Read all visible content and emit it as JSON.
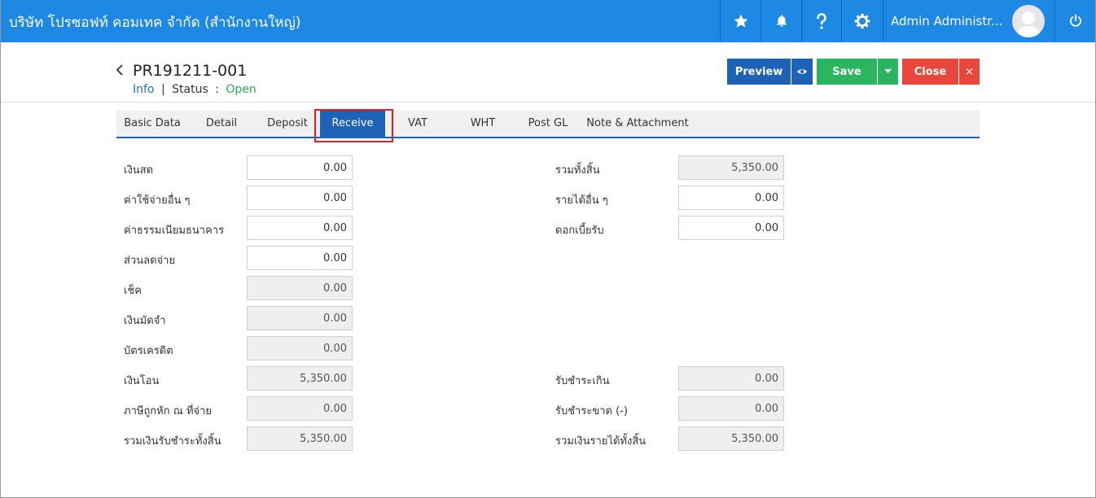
{
  "header": {
    "company": "บริษัท โปรซอฟท์ คอมเทค จำกัด (สำนักงานใหญ่)",
    "user_name": "Admin Administr...",
    "icons": [
      "star-icon",
      "bell-icon",
      "help-icon",
      "gear-icon",
      "power-icon"
    ]
  },
  "document": {
    "number": "PR191211-001",
    "info_link": "Info",
    "separator": "|",
    "status_label": "Status",
    "status_colon": ":",
    "status_value": "Open"
  },
  "actions": {
    "preview": "Preview",
    "save": "Save",
    "close": "Close",
    "close_x": "×"
  },
  "tabs": [
    {
      "label": "Basic Data",
      "active": false
    },
    {
      "label": "Detail",
      "active": false
    },
    {
      "label": "Deposit",
      "active": false
    },
    {
      "label": "Receive",
      "active": true
    },
    {
      "label": "VAT",
      "active": false
    },
    {
      "label": "WHT",
      "active": false
    },
    {
      "label": "Post GL",
      "active": false
    },
    {
      "label": "Note & Attachment",
      "active": false
    }
  ],
  "left_fields": [
    {
      "label": "เงินสด",
      "value": "0.00",
      "readonly": false
    },
    {
      "label": "ค่าใช้จ่ายอื่น ๆ",
      "value": "0.00",
      "readonly": false
    },
    {
      "label": "ค่าธรรมเนียมธนาคาร",
      "value": "0.00",
      "readonly": false
    },
    {
      "label": "ส่วนลดจ่าย",
      "value": "0.00",
      "readonly": false
    },
    {
      "label": "เช็ค",
      "value": "0.00",
      "readonly": true
    },
    {
      "label": "เงินมัดจำ",
      "value": "0.00",
      "readonly": true
    },
    {
      "label": "บัตรเครดิต",
      "value": "0.00",
      "readonly": true
    },
    {
      "label": "เงินโอน",
      "value": "5,350.00",
      "readonly": true
    },
    {
      "label": "ภาษีถูกหัก ณ ที่จ่าย",
      "value": "0.00",
      "readonly": true
    },
    {
      "label": "รวมเงินรับชำระทั้งสิ้น",
      "value": "5,350.00",
      "readonly": true
    }
  ],
  "right_fields_top": [
    {
      "label": "รวมทั้งสิ้น",
      "value": "5,350.00",
      "readonly": true
    },
    {
      "label": "รายได้อื่น ๆ",
      "value": "0.00",
      "readonly": false
    },
    {
      "label": "ดอกเบี้ยรับ",
      "value": "0.00",
      "readonly": false
    }
  ],
  "right_fields_bottom": [
    {
      "label": "รับชำระเกิน",
      "value": "0.00",
      "readonly": true
    },
    {
      "label": "รับชำระขาด (-)",
      "value": "0.00",
      "readonly": true
    },
    {
      "label": "รวมเงินรายได้ทั้งสิ้น",
      "value": "5,350.00",
      "readonly": true
    }
  ],
  "colors": {
    "topbar": "#1e88e5",
    "primary": "#1e62b6",
    "success": "#2bb561",
    "danger": "#e8483b",
    "status_open": "#2eaa55",
    "highlight": "#e02020"
  }
}
